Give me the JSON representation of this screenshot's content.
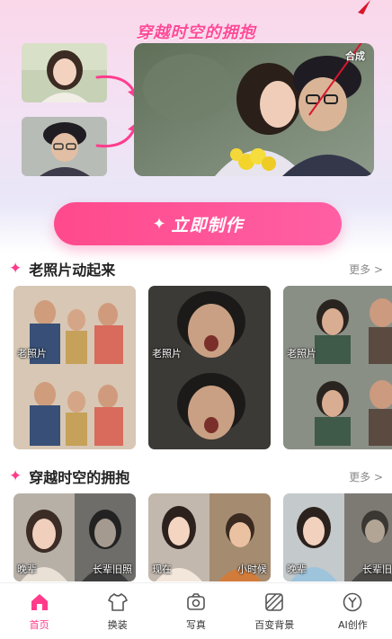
{
  "hero": {
    "title": "穿越时空的拥抱",
    "compose_tag": "合成",
    "cta_label": "立即制作",
    "accent": "#ff4a8c"
  },
  "sections": [
    {
      "title": "老照片动起来",
      "more": "更多 >",
      "cards": [
        {
          "label": "老照片"
        },
        {
          "label": "老照片"
        },
        {
          "label": "老照片"
        }
      ]
    },
    {
      "title": "穿越时空的拥抱",
      "more": "更多 >",
      "cards": [
        {
          "left": "晚辈",
          "right": "长辈旧照"
        },
        {
          "left": "现在",
          "right": "小时候"
        },
        {
          "left": "晚辈",
          "right": "长辈旧照"
        }
      ]
    }
  ],
  "tabbar": {
    "items": [
      {
        "label": "首页",
        "icon": "home-icon",
        "active": true
      },
      {
        "label": "换装",
        "icon": "shirt-icon",
        "active": false
      },
      {
        "label": "写真",
        "icon": "camera-icon",
        "active": false
      },
      {
        "label": "百变背景",
        "icon": "stripes-icon",
        "active": false
      },
      {
        "label": "AI创作",
        "icon": "ai-y-icon",
        "active": false
      }
    ],
    "active_color": "#ff3b8a"
  }
}
